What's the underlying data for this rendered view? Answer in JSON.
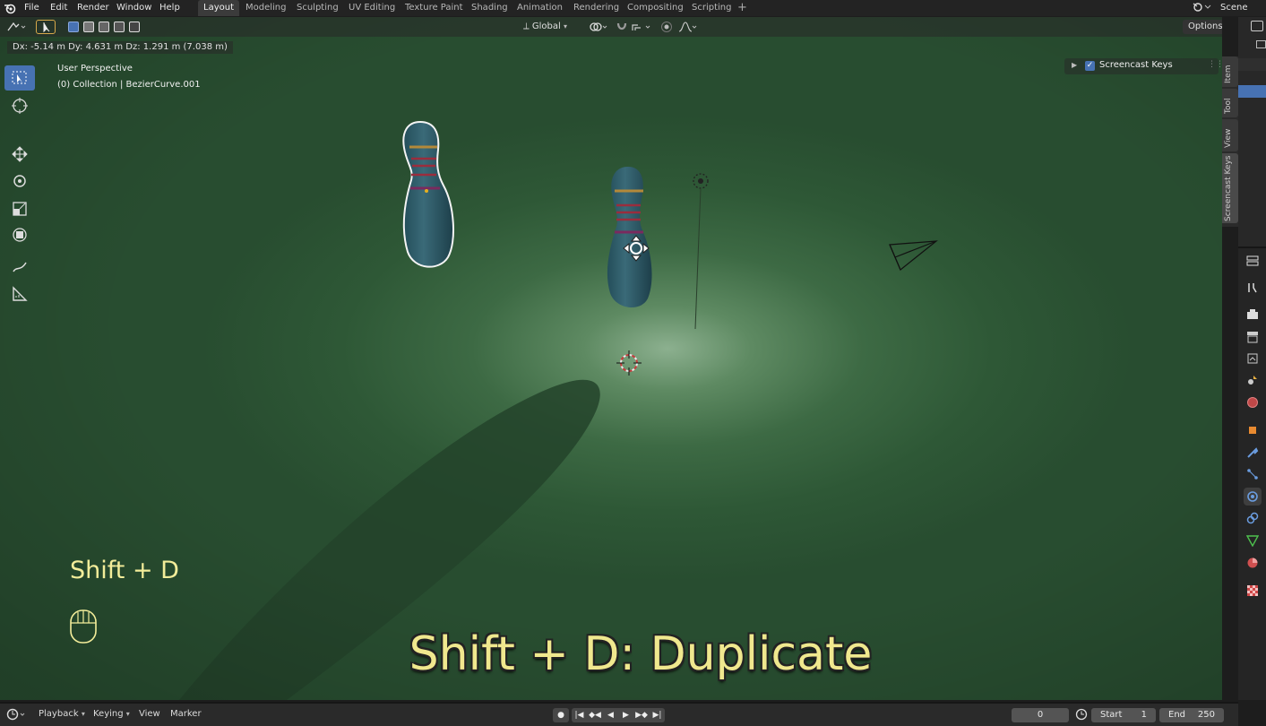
{
  "menu": {
    "items": [
      "File",
      "Edit",
      "Render",
      "Window",
      "Help"
    ]
  },
  "workspaces": {
    "tabs": [
      "Layout",
      "Modeling",
      "Sculpting",
      "UV Editing",
      "Texture Paint",
      "Shading",
      "Animation",
      "Rendering",
      "Compositing",
      "Scripting"
    ],
    "active": "Layout",
    "add_label": "+"
  },
  "scene": {
    "name": "Scene"
  },
  "viewport_header": {
    "transform_orientation": "Global",
    "options_label": "Options"
  },
  "status": {
    "transform_delta": "Dx: -5.14 m  Dy: 4.631 m  Dz: 1.291 m (7.038 m)"
  },
  "overlay": {
    "view_name": "User Perspective",
    "collection_object": "(0) Collection | BezierCurve.001"
  },
  "screencast_panel": {
    "label": "Screencast Keys",
    "enabled": true
  },
  "sidebar_tabs": [
    "Item",
    "Tool",
    "View",
    "Screencast Keys"
  ],
  "timeline": {
    "playback_label": "Playback",
    "keying_label": "Keying",
    "view_label": "View",
    "marker_label": "Marker",
    "current_frame": "0",
    "start_label": "Start",
    "start_value": "1",
    "end_label": "End",
    "end_value": "250"
  },
  "screencast": {
    "key_echo": "Shift + D",
    "caption": "Shift + D: Duplicate",
    "caption_color": "#f0e88e"
  },
  "colors": {
    "accent": "#4772b3",
    "viewport_green": "#3d6a44",
    "pin_body": "#2f5d6b"
  }
}
